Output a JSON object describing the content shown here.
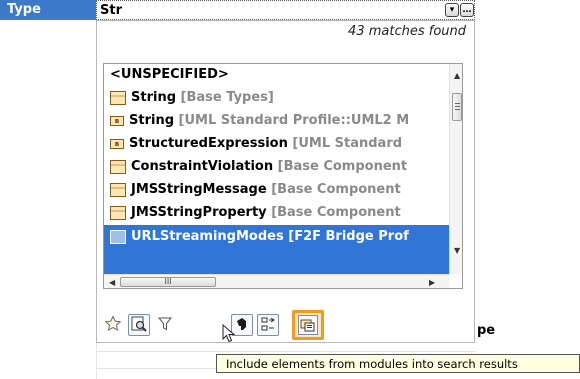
{
  "property": {
    "label": "Type",
    "value": "Str"
  },
  "popup": {
    "matches_text": "43 matches found",
    "items": [
      {
        "name": "<UNSPECIFIED>",
        "meta": "",
        "icon": "none"
      },
      {
        "name": "String",
        "meta": "[Base Types]",
        "icon": "class-icon"
      },
      {
        "name": "String",
        "meta": "[UML Standard Profile::UML2 M",
        "icon": "stereotype-icon"
      },
      {
        "name": "StructuredExpression",
        "meta": "[UML Standard",
        "icon": "stereotype-icon"
      },
      {
        "name": "ConstraintViolation",
        "meta": "[Base Component",
        "icon": "class-icon"
      },
      {
        "name": "JMSStringMessage",
        "meta": "[Base Component",
        "icon": "class-icon"
      },
      {
        "name": "JMSStringProperty",
        "meta": "[Base Component",
        "icon": "class-icon"
      },
      {
        "name": "URLStreamingModes",
        "meta": "[F2F Bridge Prof",
        "icon": "enumeration-icon",
        "selected": true
      }
    ],
    "scrollbar_grip": "III",
    "toolbar": [
      {
        "name": "favorites-icon"
      },
      {
        "name": "find-icon"
      },
      {
        "name": "filter-icon"
      },
      {
        "name": "include-modules-icon",
        "highlighted": true
      },
      {
        "name": "black-pawn-icon"
      },
      {
        "name": "expand-tree-icon"
      }
    ]
  },
  "tooltip": {
    "text": "Include elements from modules into search results"
  },
  "partial_text": "pe",
  "colors": {
    "selection": "#3176d6",
    "header": "#3c79c8",
    "highlight_border": "#f29a1b",
    "tooltip_bg": "#ffffe1"
  }
}
